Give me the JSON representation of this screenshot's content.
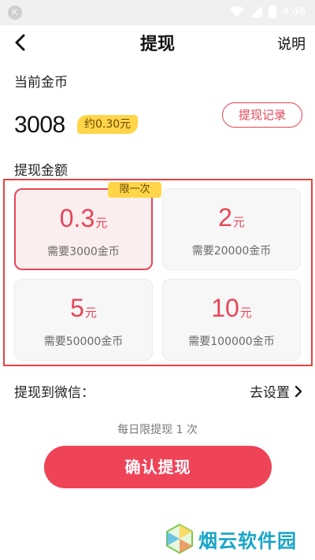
{
  "statusbar": {
    "time": "4:46"
  },
  "header": {
    "title": "提现",
    "right_label": "说明"
  },
  "balance": {
    "label": "当前金币",
    "coins": "3008",
    "approx": "约0.30元",
    "record_button": "提现记录"
  },
  "withdraw": {
    "label": "提现金额",
    "badge": "限一次",
    "options": [
      {
        "amount": "0.3",
        "unit": "元",
        "need": "需要3000金币",
        "selected": true
      },
      {
        "amount": "2",
        "unit": "元",
        "need": "需要20000金币",
        "selected": false
      },
      {
        "amount": "5",
        "unit": "元",
        "need": "需要50000金币",
        "selected": false
      },
      {
        "amount": "10",
        "unit": "元",
        "need": "需要100000金币",
        "selected": false
      }
    ]
  },
  "wechat": {
    "label": "提现到微信：",
    "action": "去设置"
  },
  "limit_text": "每日限提现 1 次",
  "confirm_button": "确认提现",
  "watermark": {
    "text": "烟云软件园"
  },
  "colors": {
    "accent": "#ef4358",
    "badge": "#ffd54a",
    "highlight_box": "#e8403f",
    "watermark": "#18a5c7"
  }
}
